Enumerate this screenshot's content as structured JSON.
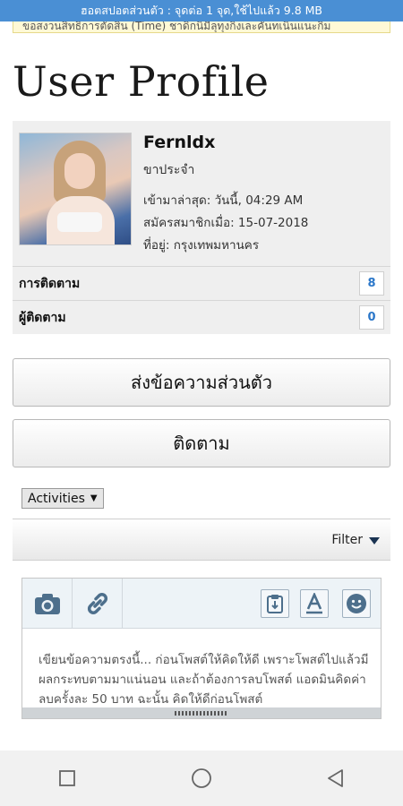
{
  "status_bar": {
    "text": "ฮอตสปอตส่วนตัว : จุดต่อ 1 จุด,ใช้ไปแล้ว 9.8 MB"
  },
  "notice": {
    "text": "ขอสงวนสิทธิ์การตัดสิน (Time) ชาดิกนิมีลุทุงกิ่งเละคันทเนินแนะกิม"
  },
  "page": {
    "title": "User Profile"
  },
  "profile": {
    "username": "Fernldx",
    "rank": "ขาประจำ",
    "last_seen": "เข้ามาล่าสุด: วันนี้, 04:29 AM",
    "joined": "สมัครสมาชิกเมื่อ: 15-07-2018",
    "location": "ที่อยู่: กรุงเทพมหานคร"
  },
  "stats": [
    {
      "label": "การติดตาม",
      "count": "8"
    },
    {
      "label": "ผู้ติดตาม",
      "count": "0"
    }
  ],
  "buttons": {
    "private_message": "ส่งข้อความส่วนตัว",
    "follow": "ติดตาม"
  },
  "activities_select": {
    "value": "Activities"
  },
  "filter": {
    "label": "Filter"
  },
  "editor": {
    "placeholder": "เขียนข้อความตรงนี้... ก่อนโพสต์ให้คิดให้ดี เพราะโพสต์ไปแล้วมีผลกระทบตามมาแน่นอน และถ้าต้องการลบโพสต์ แอดมินคิดค่าลบครั้งละ 50 บาท ฉะนั้น คิดให้ดีก่อนโพสต์"
  },
  "colors": {
    "status_bar": "#4a8fd4",
    "link": "#2b77c9",
    "icon": "#4d6f8c"
  },
  "icons": [
    "camera-icon",
    "link-icon",
    "clipboard-icon",
    "font-icon",
    "smiley-icon",
    "square-icon",
    "circle-icon",
    "back-triangle-icon"
  ]
}
